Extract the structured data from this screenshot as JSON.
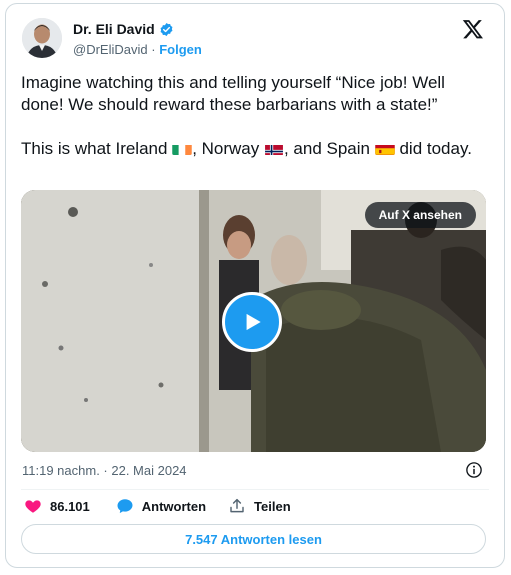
{
  "author": {
    "name": "Dr. Eli David",
    "handle": "@DrEliDavid",
    "separator": "·",
    "follow_label": "Folgen"
  },
  "tweet": {
    "paragraph1": "Imagine watching this and telling yourself “Nice job! Well done! We should reward these barbarians with a state!”",
    "p2_part1": "This is what Ireland ",
    "p2_part2": ", Norway ",
    "p2_part3": ", and Spain ",
    "p2_part4": " did today."
  },
  "media": {
    "view_label": "Auf X ansehen"
  },
  "meta": {
    "timestamp": "11:19 nachm. · 22. Mai 2024"
  },
  "actions": {
    "likes": "86.101",
    "reply_label": "Antworten",
    "share_label": "Teilen"
  },
  "read_replies": "7.547 Antworten lesen",
  "colors": {
    "accent": "#1d9bf0",
    "like": "#f91880",
    "text": "#0f1419",
    "muted": "#536471"
  },
  "icons": [
    "x-logo-icon",
    "verified-badge-icon",
    "play-icon",
    "info-icon",
    "heart-icon",
    "reply-icon",
    "share-icon",
    "flag-ireland-icon",
    "flag-norway-icon",
    "flag-spain-icon"
  ]
}
